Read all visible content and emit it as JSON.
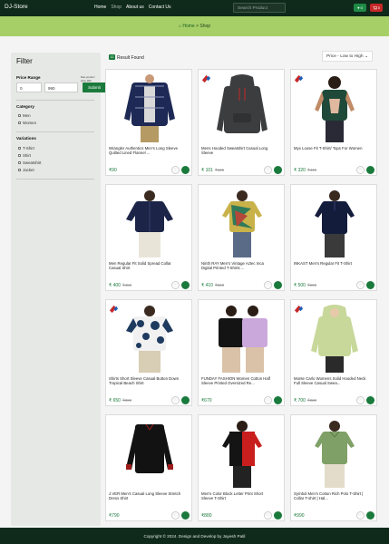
{
  "nav": {
    "brand": "DJ-Store",
    "links": [
      "Home",
      "Shop",
      "About us",
      "Contact Us"
    ],
    "search_placeholder": "Search Product",
    "wishlist_count": "0",
    "cart_count": "0"
  },
  "breadcrumb": {
    "home": "Home",
    "sep": ">",
    "current": "Shop"
  },
  "sidebar": {
    "title": "Filter",
    "price_label": "Price Range",
    "price_hint": "Max product price 990",
    "min_value": "0",
    "max_value": "990",
    "submit": "Submit",
    "category_label": "Category",
    "categories": [
      "Men",
      "Women"
    ],
    "variations_label": "Variations",
    "variations": [
      "T-Shirt",
      "Shirt",
      "Sweatshirt",
      "Jacket"
    ]
  },
  "results": {
    "count": "12",
    "label": "Result Found"
  },
  "sort": {
    "selected": "Price - Low to High"
  },
  "products": [
    {
      "title": "Wrangler Authentics Men's Long Sleeve Quilted Lined Flannel ...",
      "price": "₹90",
      "mrp": "",
      "offer": false
    },
    {
      "title": "Mens Hooded Sweatshirt Casual Long Sleeve",
      "price": "₹ 101",
      "mrp": "₹125",
      "offer": true
    },
    {
      "title": "Myx Loose Fit T-Shirt/ Tops For Women",
      "price": "₹ 320",
      "mrp": "₹449",
      "offer": true
    },
    {
      "title": "Men Regular Fit Solid Spread Collar Casual Shirt",
      "price": "₹ 400",
      "mrp": "₹450",
      "offer": false
    },
    {
      "title": "Ninth RAY Men's Vintage Aztec Inca Digital Printed T-Shirts ...",
      "price": "₹ 410",
      "mrp": "₹500",
      "offer": false
    },
    {
      "title": "INKAST Men's Regular Fit T-Shirt",
      "price": "₹ 500",
      "mrp": "₹690",
      "offer": false
    },
    {
      "title": "Shirts Short Sleeve Casual Button Down Tropical Beach Shirt",
      "price": "₹ 650",
      "mrp": "₹899",
      "offer": true
    },
    {
      "title": "FUNDAY FASHION Women Cotton Half Sleeve Printed Oversized Re...",
      "price": "₹670",
      "mrp": "",
      "offer": false
    },
    {
      "title": "Monte Carlo Womens Solid Hooded Neck Full Sleeve Casual Swea...",
      "price": "₹ 700",
      "mrp": "₹920",
      "offer": true
    },
    {
      "title": "J.VER Men's Casual Long Sleeve Stretch Dress Shirt",
      "price": "₹790",
      "mrp": "",
      "offer": false
    },
    {
      "title": "Men's Color Block Letter Print Short Sleeve T-Shirt",
      "price": "₹880",
      "mrp": "",
      "offer": false
    },
    {
      "title": "Symbol Men's Cotton Rich Polo T-Shirt | Collar T-shirt | Hal...",
      "price": "₹990",
      "mrp": "",
      "offer": false
    }
  ],
  "footer": {
    "text": "Copyright © 2024. Design and Develop by Jayesh Patil"
  },
  "colors": {
    "nav": "#0f2a1a",
    "accent": "#1a7a3c",
    "banner": "#a6cf68",
    "sale": "#c62828"
  }
}
